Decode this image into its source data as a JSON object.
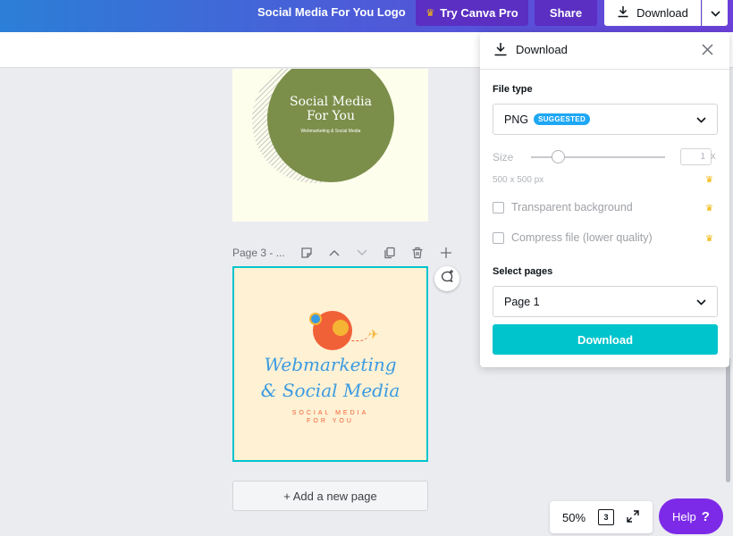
{
  "topbar": {
    "doc_title": "Social Media For You Logo",
    "try_pro_label": "Try Canva Pro",
    "share_label": "Share",
    "download_label": "Download"
  },
  "canvas": {
    "page2": {
      "title_line1": "Social Media",
      "title_line2": "For You",
      "subtitle": "Webmarketing & Social Media"
    },
    "page3": {
      "label": "Page 3 - ...",
      "script_line1": "Webmarketing",
      "script_line2": "& Social Media",
      "tagline_line1": "SOCIAL MEDIA",
      "tagline_line2": "FOR YOU"
    },
    "add_page_label": "+ Add a new page"
  },
  "footer": {
    "zoom": "50%",
    "page_count": "3",
    "help_label": "Help",
    "help_symbol": "?"
  },
  "download_panel": {
    "title": "Download",
    "file_type_label": "File type",
    "file_type_value": "PNG",
    "suggested_badge": "SUGGESTED",
    "size_label": "Size",
    "size_value": "1",
    "size_multiplier": "x",
    "dimensions": "500 x 500 px",
    "transparent_label": "Transparent background",
    "compress_label": "Compress file (lower quality)",
    "select_pages_label": "Select pages",
    "pages_value": "Page 1",
    "download_button": "Download"
  },
  "colors": {
    "accent": "#00c4cc",
    "purple": "#7d2ae8",
    "pro_button": "#5a2fc2"
  }
}
